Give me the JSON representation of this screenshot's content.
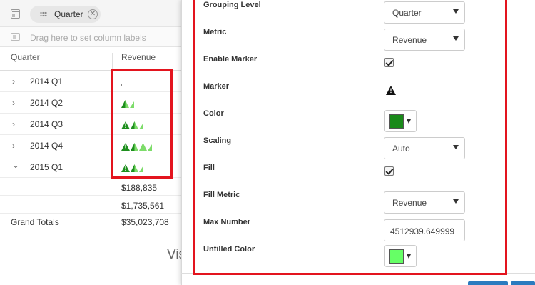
{
  "grid": {
    "group_chip_label": "Quarter",
    "column_hint": "Drag here to set column labels",
    "headers": {
      "quarter": "Quarter",
      "revenue": "Revenue"
    },
    "rows": [
      {
        "label": "2014 Q1",
        "expanded": false,
        "marker_shape": "tick"
      },
      {
        "label": "2014 Q2",
        "expanded": false,
        "marker_shape": "half-half-light"
      },
      {
        "label": "2014 Q3",
        "expanded": false,
        "marker_shape": "warn-half-light"
      },
      {
        "label": "2014 Q4",
        "expanded": false,
        "marker_shape": "warn-half-full-light"
      },
      {
        "label": "2015 Q1",
        "expanded": true,
        "marker_shape": "warn-half-light"
      }
    ],
    "subtotals": [
      {
        "label": "",
        "value": "$188,835"
      },
      {
        "label": "",
        "value": "$1,735,561"
      }
    ],
    "grand_totals": {
      "label": "Grand Totals",
      "value": "$35,023,708"
    },
    "chevron_collapsed": "›",
    "chevron_expanded": "⌄"
  },
  "background_text": "Vis",
  "panel": {
    "grouping_level": {
      "label": "Grouping Level",
      "value": "Quarter"
    },
    "metric": {
      "label": "Metric",
      "value": "Revenue"
    },
    "enable_marker": {
      "label": "Enable Marker",
      "checked": true
    },
    "marker": {
      "label": "Marker",
      "icon": "warning-triangle-icon"
    },
    "color": {
      "label": "Color",
      "value": "#1a8a1a"
    },
    "scaling": {
      "label": "Scaling",
      "value": "Auto"
    },
    "fill": {
      "label": "Fill",
      "checked": true
    },
    "fill_metric": {
      "label": "Fill Metric",
      "value": "Revenue"
    },
    "max_number": {
      "label": "Max Number",
      "value": "4512939.649999"
    },
    "unfilled_color": {
      "label": "Unfilled Color",
      "value": "#66ff66"
    }
  },
  "colors": {
    "highlight": "#e3141e",
    "marker_dark": "#1e8f1e",
    "marker_light": "#7ddc6a",
    "footer_button": "#2b7bbf"
  }
}
